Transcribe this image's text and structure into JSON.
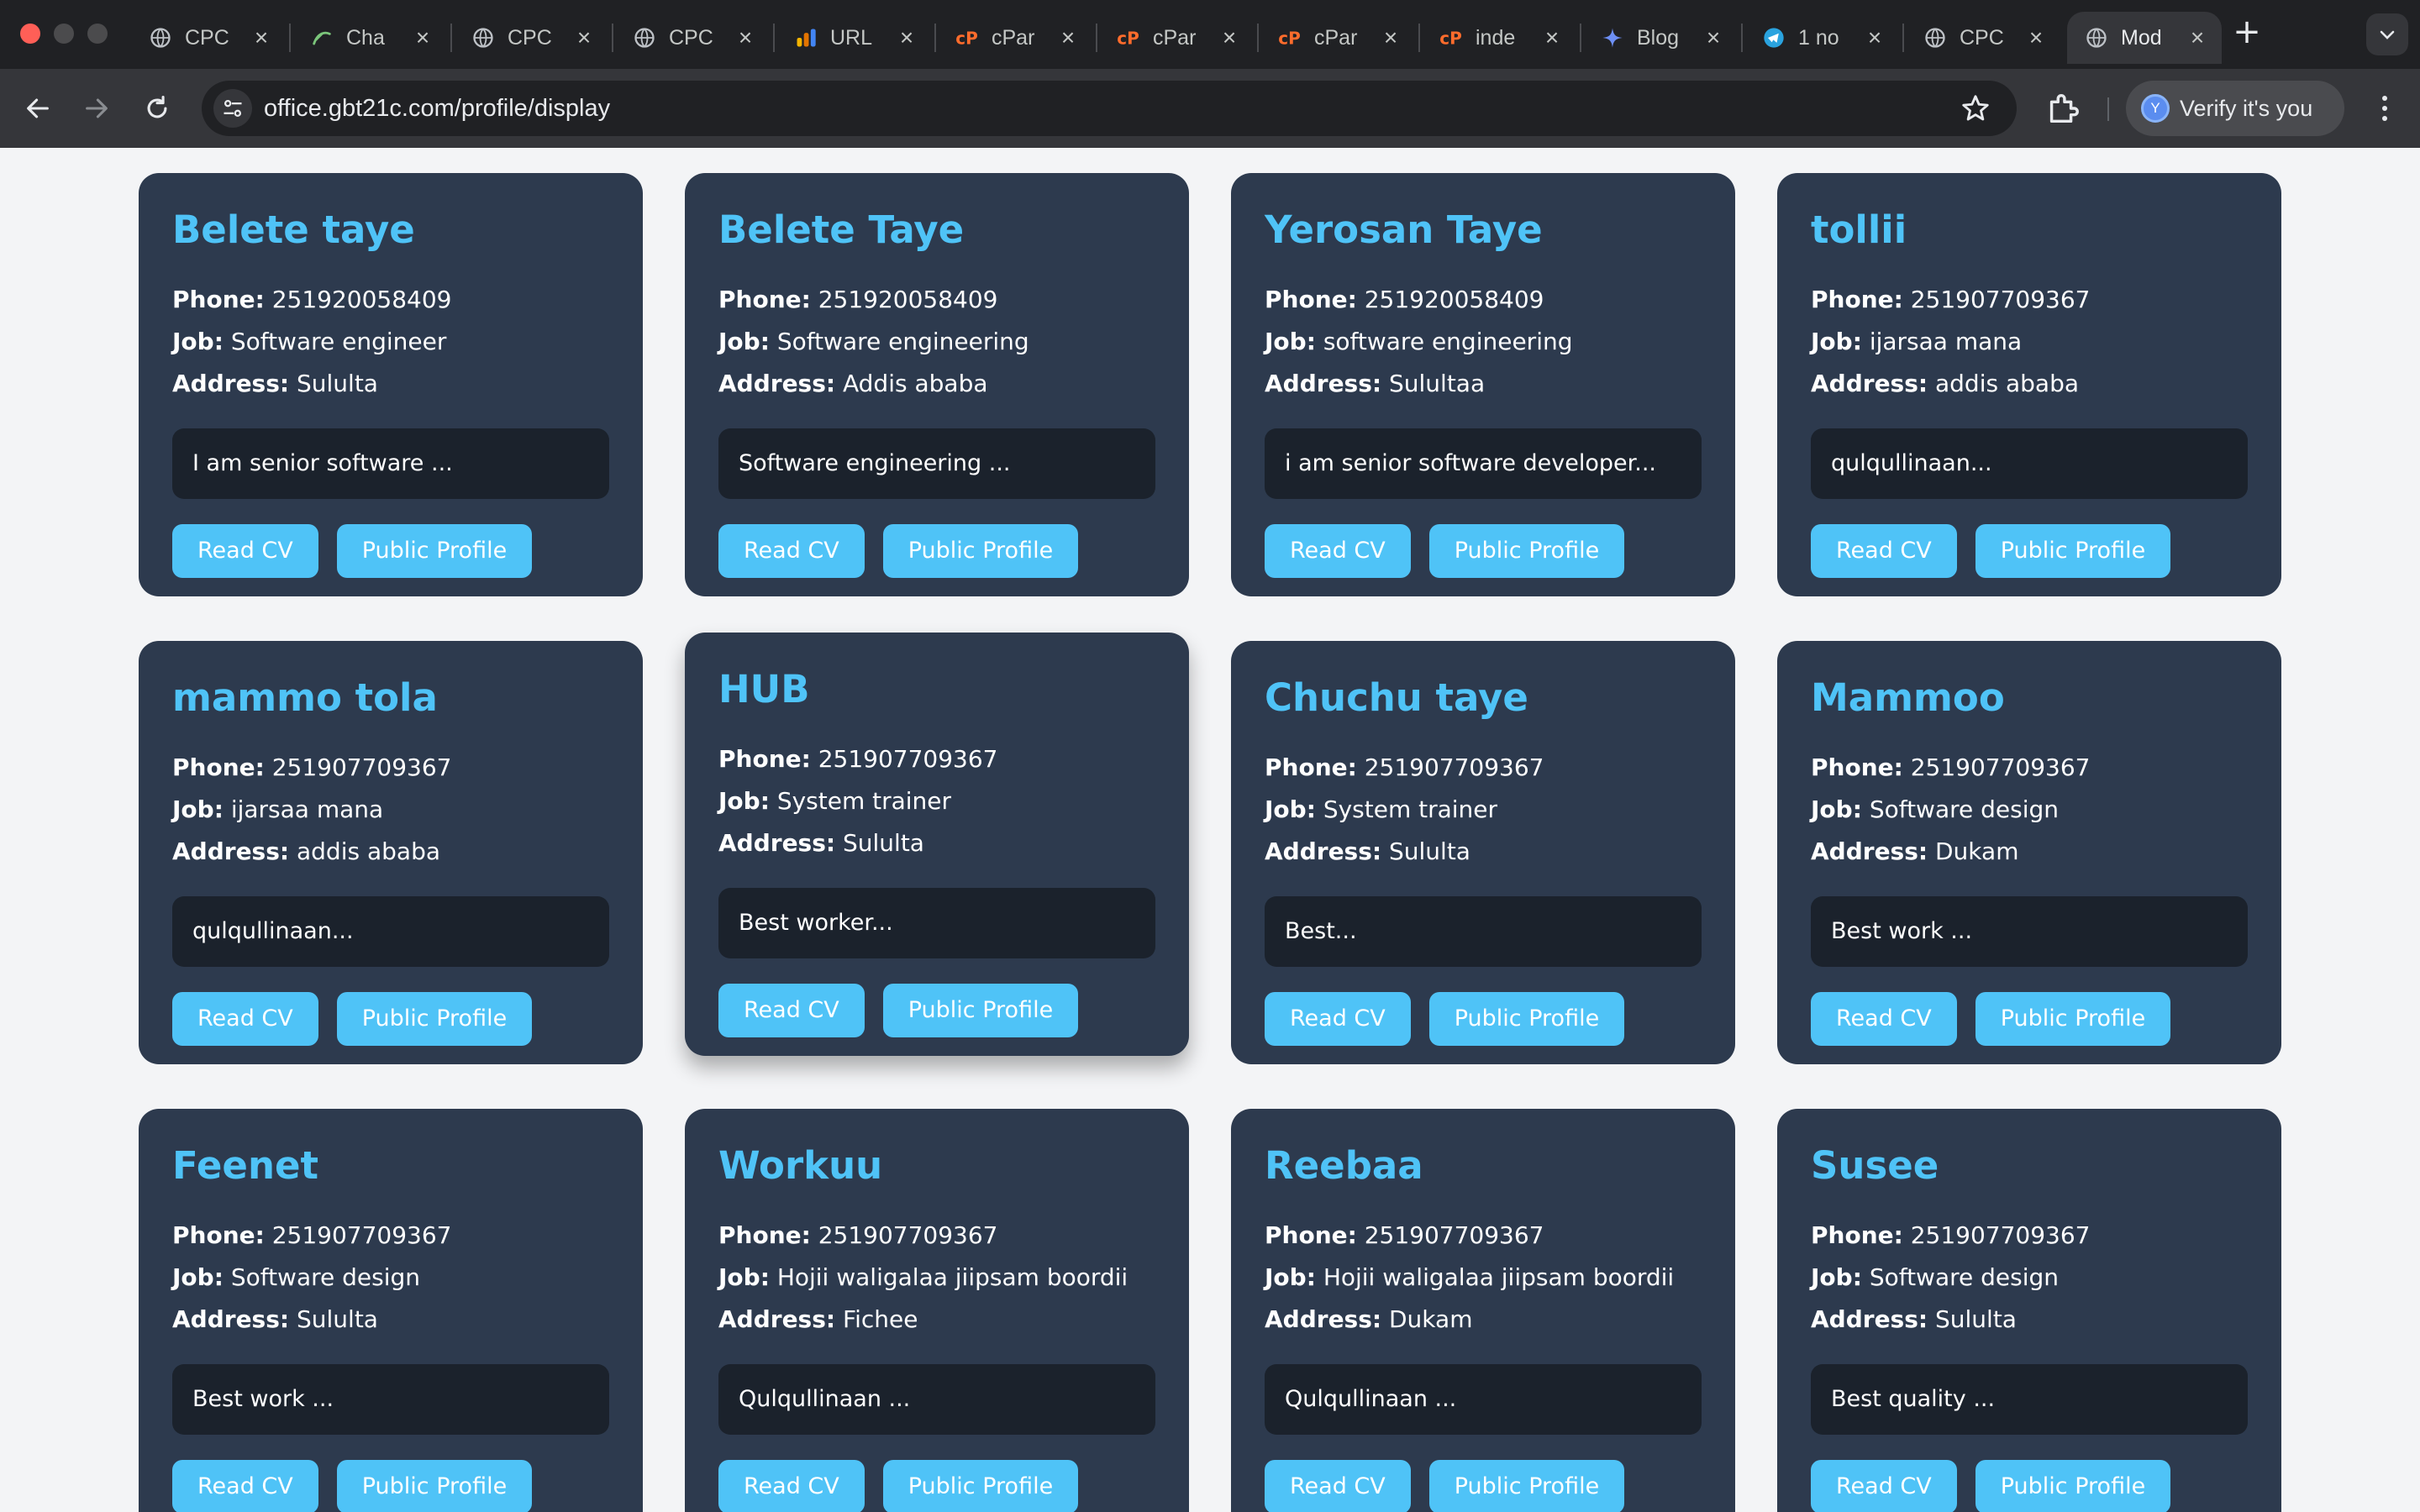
{
  "browser": {
    "tabs": [
      {
        "title": "CPC",
        "icon": "globe-icon",
        "active": false
      },
      {
        "title": "Cha",
        "icon": "chatgpt-icon",
        "active": false
      },
      {
        "title": "CPC",
        "icon": "globe-icon",
        "active": false
      },
      {
        "title": "CPC",
        "icon": "globe-icon",
        "active": false
      },
      {
        "title": "URL",
        "icon": "analytics-icon",
        "active": false
      },
      {
        "title": "cPar",
        "icon": "cpanel-icon",
        "active": false
      },
      {
        "title": "cPar",
        "icon": "cpanel-icon",
        "active": false
      },
      {
        "title": "cPar",
        "icon": "cpanel-icon",
        "active": false
      },
      {
        "title": "inde",
        "icon": "cpanel-icon",
        "active": false
      },
      {
        "title": "Blog",
        "icon": "gemini-icon",
        "active": false
      },
      {
        "title": "1 no",
        "icon": "telegram-icon",
        "active": false
      },
      {
        "title": "CPC",
        "icon": "globe-icon",
        "active": false
      },
      {
        "title": "Mod",
        "icon": "globe-icon",
        "active": true
      }
    ],
    "url": "office.gbt21c.com/profile/display",
    "profile_chip": "Verify it's you",
    "avatar_letter": "Y"
  },
  "cards": [
    {
      "name": "Belete taye",
      "phone": "251920058409",
      "job": "Software engineer",
      "address": "Sululta",
      "bio": "I am senior software ..."
    },
    {
      "name": "Belete Taye",
      "phone": "251920058409",
      "job": "Software engineering",
      "address": "Addis ababa",
      "bio": "Software engineering ..."
    },
    {
      "name": "Yerosan Taye",
      "phone": "251920058409",
      "job": "software engineering",
      "address": "Sulultaa",
      "bio": "i am senior software developer..."
    },
    {
      "name": "tollii",
      "phone": "251907709367",
      "job": "ijarsaa mana",
      "address": "addis ababa",
      "bio": "qulqullinaan..."
    },
    {
      "name": "mammo tola",
      "phone": "251907709367",
      "job": "ijarsaa mana",
      "address": "addis ababa",
      "bio": "qulqullinaan..."
    },
    {
      "name": "HUB",
      "phone": "251907709367",
      "job": "System trainer",
      "address": "Sululta",
      "bio": "Best worker...",
      "hovered": true
    },
    {
      "name": "Chuchu taye",
      "phone": "251907709367",
      "job": "System trainer",
      "address": "Sululta",
      "bio": "Best..."
    },
    {
      "name": "Mammoo",
      "phone": "251907709367",
      "job": "Software design",
      "address": "Dukam",
      "bio": "Best work ..."
    },
    {
      "name": "Feenet",
      "phone": "251907709367",
      "job": "Software design",
      "address": "Sululta",
      "bio": "Best work ..."
    },
    {
      "name": "Workuu",
      "phone": "251907709367",
      "job": "Hojii waligalaa jiipsam boordii",
      "address": "Fichee",
      "bio": "Qulqullinaan ..."
    },
    {
      "name": "Reebaa",
      "phone": "251907709367",
      "job": "Hojii waligalaa jiipsam boordii",
      "address": "Dukam",
      "bio": "Qulqullinaan ..."
    },
    {
      "name": "Susee",
      "phone": "251907709367",
      "job": "Software design",
      "address": "Sululta",
      "bio": "Best quality ..."
    }
  ],
  "labels": {
    "phone": "Phone:",
    "job": "Job:",
    "address": "Address:",
    "read_cv": "Read CV",
    "public_profile": "Public Profile"
  },
  "colors": {
    "card_bg": "#2d3a4e",
    "accent": "#4fc3f7",
    "bio_bg": "#1b222c",
    "page_bg": "#f3f4f6"
  }
}
